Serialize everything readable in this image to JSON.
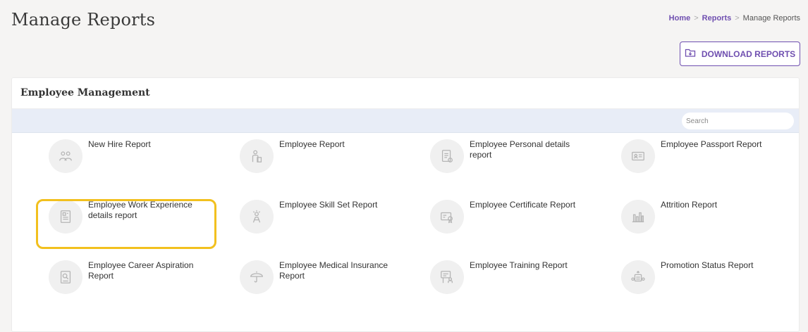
{
  "header": {
    "title": "Manage Reports",
    "breadcrumb": [
      "Home",
      "Reports",
      "Manage Reports"
    ],
    "separator": ">"
  },
  "actions": {
    "download_label": "DOWNLOAD REPORTS"
  },
  "section": {
    "title": "Employee Management",
    "search_placeholder": "Search"
  },
  "reports": [
    {
      "label": "New Hire Report",
      "icon": "new-hire-icon"
    },
    {
      "label": "Employee Report",
      "icon": "employee-icon"
    },
    {
      "label": "Employee Personal details report",
      "icon": "personal-details-icon"
    },
    {
      "label": "Employee Passport Report",
      "icon": "passport-icon"
    },
    {
      "label": "Employee Work Experience details report",
      "icon": "work-experience-icon"
    },
    {
      "label": "Employee Skill Set Report",
      "icon": "skill-set-icon"
    },
    {
      "label": "Employee Certificate Report",
      "icon": "certificate-icon"
    },
    {
      "label": "Attrition Report",
      "icon": "attrition-chart-icon"
    },
    {
      "label": "Employee Career Aspiration Report",
      "icon": "career-aspiration-icon"
    },
    {
      "label": "Employee Medical Insurance Report",
      "icon": "medical-insurance-icon"
    },
    {
      "label": "Employee Training Report",
      "icon": "training-icon"
    },
    {
      "label": "Promotion Status Report",
      "icon": "promotion-status-icon"
    }
  ],
  "colors": {
    "accent": "#6f4fb0",
    "highlight": "#f2c01e",
    "search_bar_bg": "#e8edf7"
  }
}
